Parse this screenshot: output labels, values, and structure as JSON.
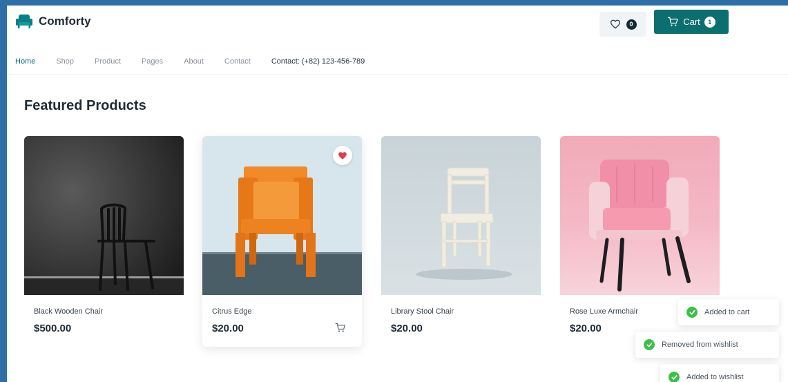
{
  "brand": {
    "name": "Comforty",
    "icon": "armchair-icon"
  },
  "header": {
    "wishlist_count": "0",
    "cart_label": "Cart",
    "cart_count": "1"
  },
  "nav": {
    "items": [
      {
        "label": "Home"
      },
      {
        "label": "Shop"
      },
      {
        "label": "Product"
      },
      {
        "label": "Pages"
      },
      {
        "label": "About"
      },
      {
        "label": "Contact"
      }
    ],
    "contact": "Contact: (+82) 123-456-789"
  },
  "section": {
    "title": "Featured Products"
  },
  "products": [
    {
      "name": "Black Wooden Chair",
      "price": "$500.00"
    },
    {
      "name": "Citrus Edge",
      "price": "$20.00",
      "wishlisted": true
    },
    {
      "name": "Library Stool Chair",
      "price": "$20.00"
    },
    {
      "name": "Rose Luxe Armchair",
      "price": "$20.00"
    }
  ],
  "toasts": [
    {
      "text": "Added to cart"
    },
    {
      "text": "Removed from wishlist"
    },
    {
      "text": "Added to wishlist"
    }
  ],
  "colors": {
    "primary": "#0b6e6f",
    "success": "#3dbf4a",
    "wishlist_heart": "#e23b4a",
    "frame_bg": "#2e6fa8"
  }
}
